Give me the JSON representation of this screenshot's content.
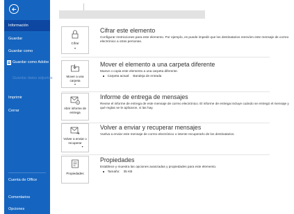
{
  "sidebar": {
    "back_icon": "arrow-left-icon",
    "items": [
      {
        "label": "Información"
      },
      {
        "label": "Guardar"
      },
      {
        "label": "Guardar como"
      },
      {
        "label": "Guardar como Adobe PDF"
      },
      {
        "label": "Guardar datos adjuntos"
      },
      {
        "label": "Imprimir"
      },
      {
        "label": "Cerrar"
      },
      {
        "label": "Cuenta de Office"
      },
      {
        "label": "Comentarios"
      },
      {
        "label": "Opciones"
      }
    ]
  },
  "sections": {
    "encrypt": {
      "button_label": "Cifrar",
      "title": "Cifrar este elemento",
      "description": "Configurar restricciones para este elemento. Por ejemplo, es puede impedir que los destinatarios reenvíen este mensaje de correo electrónico a otras personas."
    },
    "move": {
      "button_label": "Mover a una carpeta",
      "title": "Mover el elemento a una carpeta diferente",
      "description": "Mueve o copia este elemento a una carpeta diferente.",
      "bullet_label": "Carpeta actual:",
      "bullet_value": "Bandeja de entrada"
    },
    "receipt": {
      "button_label": "Abrir informe de entrega",
      "title": "Informe de entrega de mensajes",
      "description": "Revise el informe de entrega de este mensaje de correo electrónico. El informe de entrega incluye cuándo se entregó el mensaje y qué reglas se le aplicaron, si las hay."
    },
    "resend": {
      "button_label": "Volver a enviar o recuperar",
      "title": "Volver a enviar y recuperar mensajes",
      "description": "Vuelva a enviar este mensaje de correo electrónico o intente recuperarlo de los destinatarios."
    },
    "properties": {
      "button_label": "Propiedades",
      "title": "Propiedades",
      "description": "Establece y muestra las opciones avanzadas y propiedades para este elemento.",
      "bullet_label": "Tamaño:",
      "bullet_value": "35 KB"
    }
  }
}
